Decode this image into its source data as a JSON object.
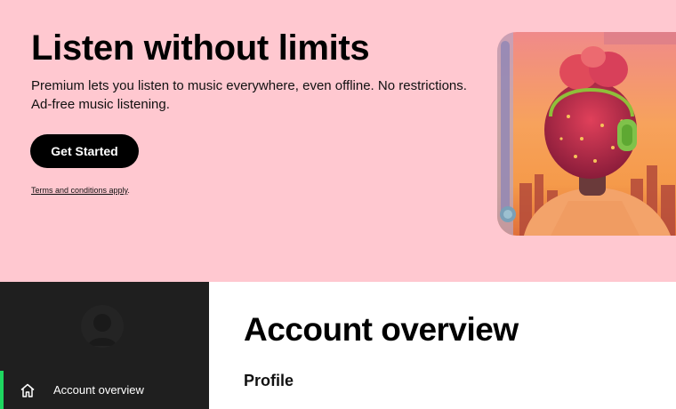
{
  "hero": {
    "title": "Listen without limits",
    "description": "Premium lets you listen to music everywhere, even offline. No restrictions. Ad-free music listening.",
    "cta_label": "Get Started",
    "terms_link": "Terms and conditions apply",
    "terms_suffix": ".",
    "background_color": "#ffc8d0"
  },
  "sidebar": {
    "background_color": "#1f1f1f",
    "accent_color": "#1ed760",
    "items": [
      {
        "label": "Account overview",
        "icon": "home-icon",
        "active": true
      }
    ]
  },
  "main": {
    "page_title": "Account overview",
    "section_title": "Profile"
  }
}
